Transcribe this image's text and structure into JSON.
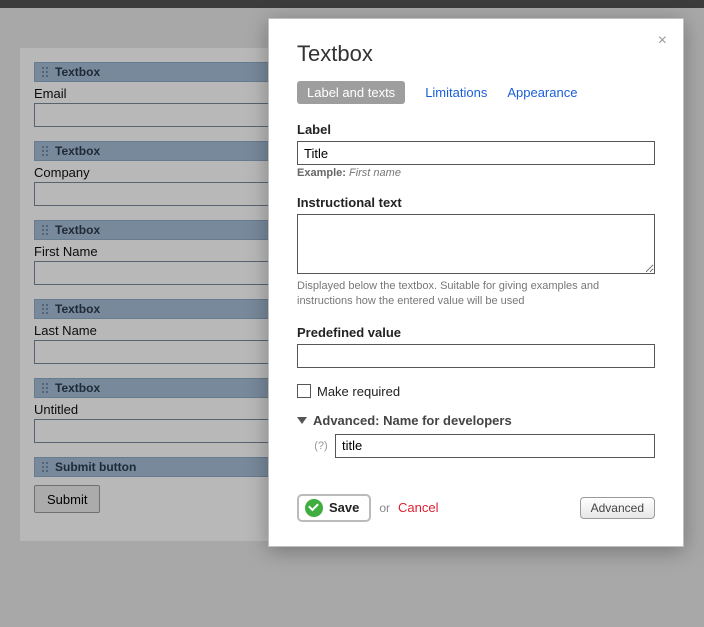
{
  "form": {
    "fields": [
      {
        "type": "Textbox",
        "label": "Email"
      },
      {
        "type": "Textbox",
        "label": "Company"
      },
      {
        "type": "Textbox",
        "label": "First Name"
      },
      {
        "type": "Textbox",
        "label": "Last Name"
      },
      {
        "type": "Textbox",
        "label": "Untitled"
      }
    ],
    "submit_header": "Submit button",
    "submit_label": "Submit"
  },
  "modal": {
    "title": "Textbox",
    "tabs": {
      "active": "Label and texts",
      "limitations": "Limitations",
      "appearance": "Appearance"
    },
    "label_section": {
      "label": "Label",
      "value": "Title",
      "example_prefix": "Example:",
      "example_value": "First name"
    },
    "instructional": {
      "label": "Instructional text",
      "value": "",
      "help": "Displayed below the textbox. Suitable for giving examples and instructions how the entered value will be used"
    },
    "predefined": {
      "label": "Predefined value",
      "value": ""
    },
    "required": {
      "label": "Make required"
    },
    "advanced_name": {
      "header": "Advanced: Name for developers",
      "hint": "(?)",
      "value": "title"
    },
    "footer": {
      "save": "Save",
      "or": "or",
      "cancel": "Cancel",
      "advanced": "Advanced"
    }
  }
}
